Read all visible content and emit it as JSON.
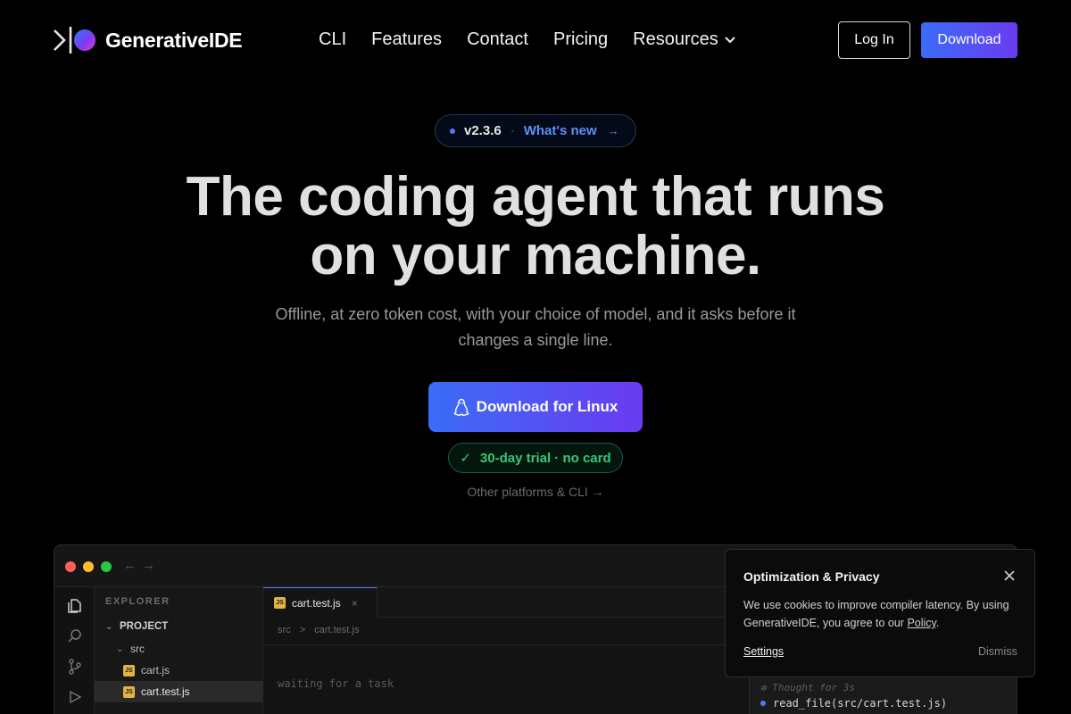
{
  "nav": {
    "brand": "GenerativeIDE",
    "menu": [
      "CLI",
      "Features",
      "Contact",
      "Pricing",
      "Resources"
    ],
    "login_label": "Log In",
    "download_label": "Download"
  },
  "hero": {
    "version": "v2.3.6",
    "separator": "·",
    "whats_new": "What's new",
    "whats_new_arrow": "→",
    "headline_line1": "The coding agent that runs",
    "headline_line2": "on your machine.",
    "subline": "Offline, at zero token cost, with your choice of model, and it asks before it changes a single line.",
    "cta_label": "Download for Linux",
    "trial_check": "✓",
    "trial_label": "30-day trial · no card",
    "other_platforms": "Other platforms & CLI →"
  },
  "ide": {
    "explorer_title": "EXPLORER",
    "project_label": "PROJECT",
    "folder": "src",
    "files": [
      "cart.js",
      "cart.test.js"
    ],
    "js_badge": "JS",
    "active_tab": "cart.test.js",
    "tab_close": "×",
    "breadcrumb": [
      "src",
      "cart.test.js"
    ],
    "breadcrumb_sep": ">",
    "waiting_text": "waiting for a task",
    "thought": "✻ Thought for 3s",
    "read_file": "read_file(src/cart.test.js)"
  },
  "cookie": {
    "title": "Optimization & Privacy",
    "text_before": "We use cookies to improve compiler latency. By using GenerativeIDE, you agree to our ",
    "policy_link": "Policy",
    "text_after": ".",
    "settings_label": "Settings",
    "dismiss_label": "Dismiss"
  },
  "colors": {
    "accent_blue": "#3b6cf6",
    "accent_purple": "#6a3bf0",
    "trial_green": "#39c67a"
  }
}
